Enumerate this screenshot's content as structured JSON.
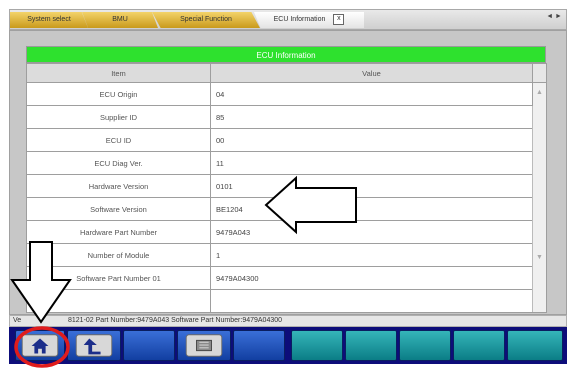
{
  "tabs": {
    "items": [
      {
        "label": "System select"
      },
      {
        "label": "BMU"
      },
      {
        "label": "Special Function"
      },
      {
        "label": "ECU Information"
      }
    ],
    "close_symbol": "x",
    "nav_arrows": "◄ ►"
  },
  "ecu_table": {
    "title": "ECU Information",
    "columns": [
      "Item",
      "Value"
    ],
    "rows": [
      {
        "item": "ECU Origin",
        "value": "04"
      },
      {
        "item": "Supplier ID",
        "value": "85"
      },
      {
        "item": "ECU ID",
        "value": "00"
      },
      {
        "item": "ECU Diag Ver.",
        "value": "11"
      },
      {
        "item": "Hardware Version",
        "value": "0101"
      },
      {
        "item": "Software Version",
        "value": "BE1204"
      },
      {
        "item": "Hardware Part Number",
        "value": "9479A043"
      },
      {
        "item": "Number of Module",
        "value": "1"
      },
      {
        "item": "Software Part Number 01",
        "value": "9479A04300"
      },
      {
        "item": "",
        "value": ""
      }
    ]
  },
  "status_line": "8121-02 Part Number:9479A043   Software Part Number:9479A04300",
  "status_prefix": "Ve",
  "bottom_bar": {
    "buttons": [
      {
        "icon": "home-icon"
      },
      {
        "icon": "back-arrow-icon"
      },
      {
        "icon": ""
      },
      {
        "icon": "ecu-icon"
      },
      {
        "icon": ""
      },
      {
        "icon": ""
      },
      {
        "icon": ""
      },
      {
        "icon": ""
      },
      {
        "icon": ""
      }
    ]
  },
  "colors": {
    "tab_gold": "#e2b437",
    "table_header_green": "#2ee12e",
    "bar_navy": "#0d0d7a",
    "button_blue": "#2458c4",
    "button_teal": "#1a9aa0",
    "annotation_red": "#e01c1c"
  }
}
